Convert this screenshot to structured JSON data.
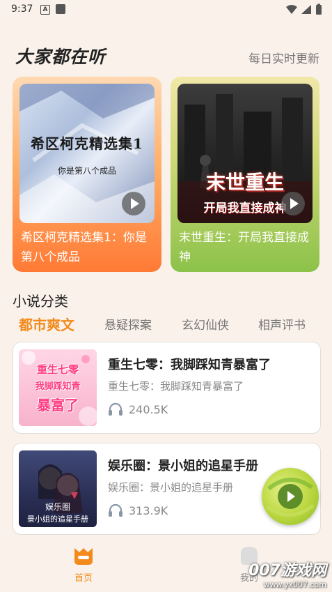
{
  "status_bar": {
    "time": "9:37",
    "notif_letter": "A"
  },
  "header": {
    "title": "大家都在听",
    "subtitle": "每日实时更新"
  },
  "featured": [
    {
      "title": "希区柯克精选集1：你是第八个成品",
      "cover_title": "希区柯克精选集1",
      "cover_subtitle": "你是第八个成品",
      "color": "#ff8a3d"
    },
    {
      "title": "末世重生：开局我直接成神",
      "cover_title": "末世重生",
      "cover_subtitle": "开局我直接成神",
      "color": "#8cc24a"
    }
  ],
  "categories": {
    "title": "小说分类",
    "tabs": [
      "都市爽文",
      "悬疑探案",
      "玄幻仙侠",
      "相声评书"
    ],
    "active_tab": "都市爽文"
  },
  "books": [
    {
      "title": "重生七零：我脚踩知青暴富了",
      "desc": "重生七零：我脚踩知青暴富了",
      "plays": "240.5K",
      "cover_lines": [
        "重生七零",
        "我脚踩知青",
        "暴富了"
      ]
    },
    {
      "title": "娱乐圈：景小姐的追星手册",
      "desc": "娱乐圈：景小姐的追星手册",
      "plays": "313.9K",
      "cover_lines": [
        "娱乐圈",
        "景小姐的追星手册"
      ]
    }
  ],
  "bottom_nav": {
    "home": "首页",
    "me": "我的"
  },
  "watermark": {
    "brand": "007游戏网",
    "url": "www.yx007.com"
  },
  "colors": {
    "accent": "#f28a1c",
    "background": "#faf2ea"
  }
}
